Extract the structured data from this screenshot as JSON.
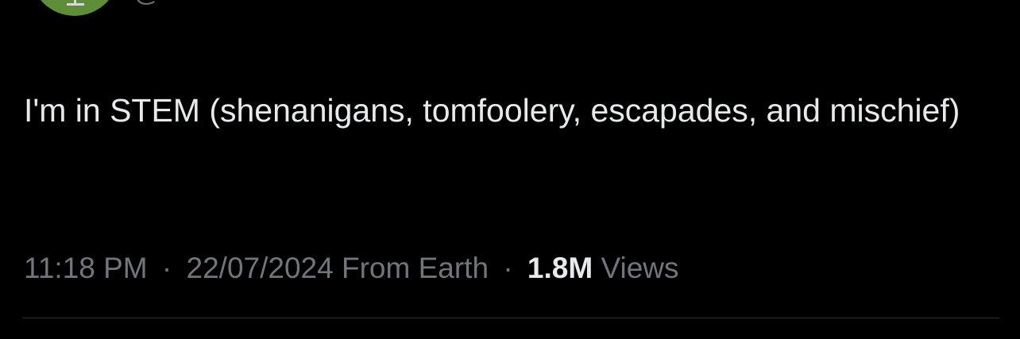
{
  "tweet": {
    "author_handle": "@",
    "text": "I'm in STEM (shenanigans, tomfoolery, escapades, and mischief)",
    "time": "11:18 PM",
    "date": "22/07/2024",
    "source": "From Earth",
    "separator": "·",
    "views_count": "1.8M",
    "views_label": "Views"
  }
}
